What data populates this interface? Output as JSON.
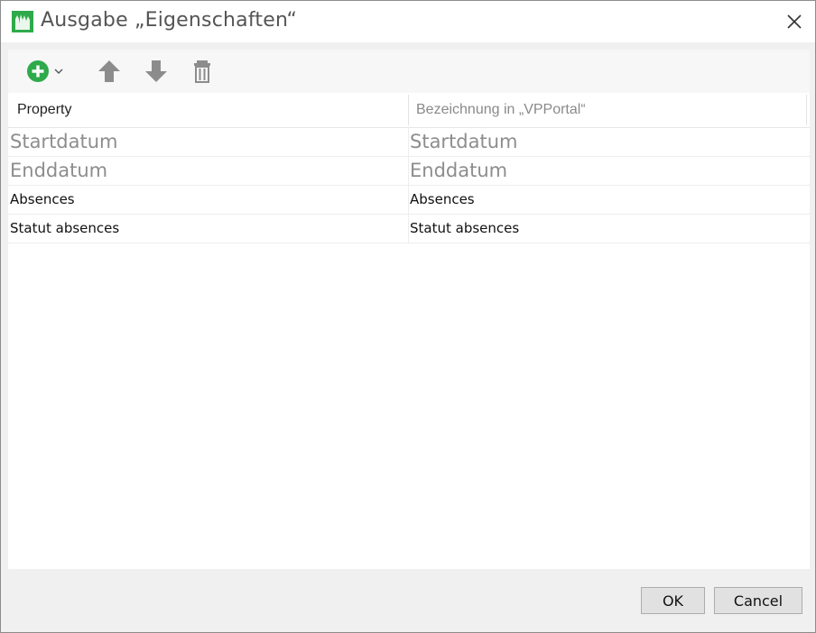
{
  "window": {
    "title": "Ausgabe „Eigenschaften“"
  },
  "toolbar": {
    "icons": [
      "add-icon",
      "chevron-down-icon",
      "arrow-up-icon",
      "arrow-down-icon",
      "trash-icon"
    ]
  },
  "table": {
    "columns": [
      "Property",
      "Bezeichnung in „VPPortal“"
    ],
    "rows": [
      {
        "property": "Startdatum",
        "label": "Startdatum"
      },
      {
        "property": "Enddatum",
        "label": "Enddatum"
      },
      {
        "property": "Absences",
        "label": "Absences"
      },
      {
        "property": "Statut absences",
        "label": "Statut absences"
      }
    ]
  },
  "footer": {
    "ok_label": "OK",
    "cancel_label": "Cancel"
  },
  "colors": {
    "accent_green": "#2eaa4a",
    "icon_gray": "#8c8c8c"
  }
}
